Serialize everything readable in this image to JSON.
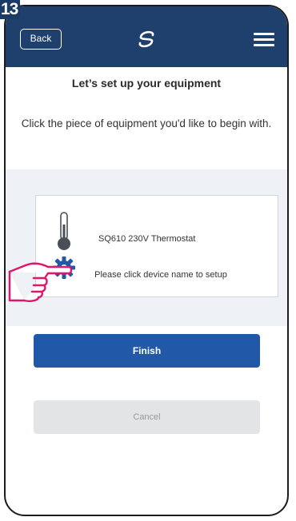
{
  "step": {
    "number": "13"
  },
  "header": {
    "back_label": "Back",
    "logo_icon": "salus-swirl-icon",
    "menu_icon": "hamburger-menu-icon"
  },
  "main": {
    "title": "Let’s set up your equipment",
    "subtitle": "Click the piece of equipment you'd like to begin with."
  },
  "device": {
    "name": "SQ610 230V Thermostat",
    "hint": "Please click device name to setup",
    "icons": [
      "thermometer-icon",
      "gear-icon",
      "pointing-hand-icon"
    ]
  },
  "actions": {
    "finish_label": "Finish",
    "cancel_label": "Cancel"
  },
  "colors": {
    "header": "#1f3f6d",
    "primary": "#2158a8",
    "accent": "#e0166a",
    "band": "#eef2f7"
  }
}
